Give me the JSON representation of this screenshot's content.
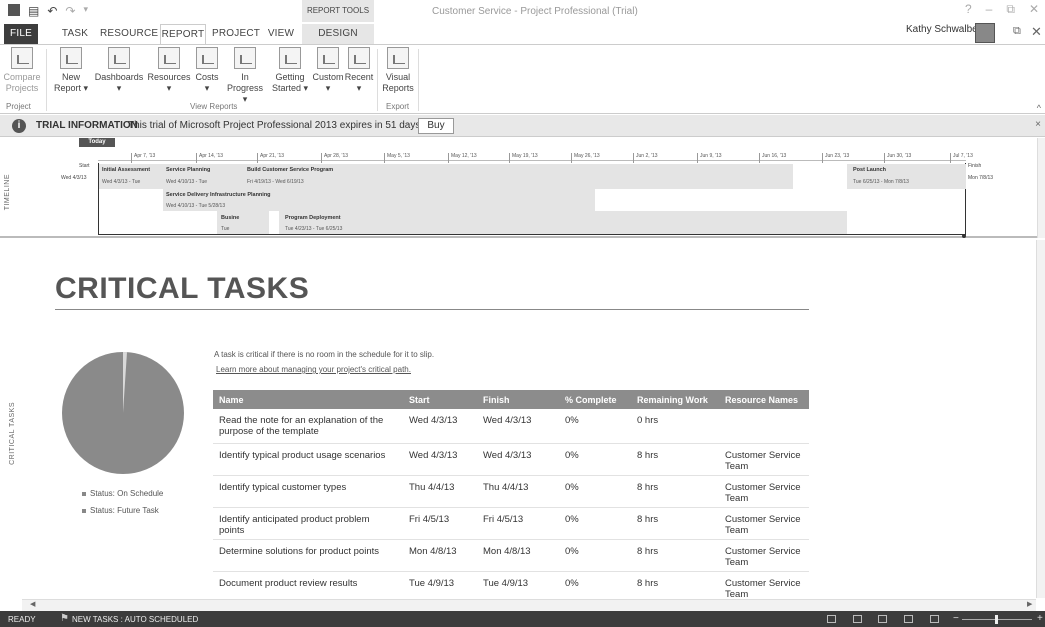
{
  "titlebar": {
    "context_title": "REPORT TOOLS",
    "doc_title": "Customer Service - Project Professional (Trial)",
    "help": "?",
    "minimize": "–",
    "restore": "⧉",
    "close": "✕"
  },
  "tabs": [
    {
      "label": "FILE"
    },
    {
      "label": "TASK"
    },
    {
      "label": "RESOURCE"
    },
    {
      "label": "REPORT"
    },
    {
      "label": "PROJECT"
    },
    {
      "label": "VIEW"
    },
    {
      "label": "DESIGN"
    }
  ],
  "user": {
    "name": "Kathy Schwalbe ▾",
    "restore": "⧉",
    "close": "✕"
  },
  "ribbon": {
    "buttons": [
      {
        "label1": "Compare",
        "label2": "Projects",
        "icon": "compare-projects-icon"
      },
      {
        "label1": "New",
        "label2": "Report ▾",
        "icon": "new-report-icon"
      },
      {
        "label1": "Dashboards",
        "label2": "▾",
        "icon": "dashboards-icon"
      },
      {
        "label1": "Resources",
        "label2": "▾",
        "icon": "resources-icon"
      },
      {
        "label1": "Costs",
        "label2": "▾",
        "icon": "costs-icon"
      },
      {
        "label1": "In Progress",
        "label2": "▾",
        "icon": "in-progress-icon"
      },
      {
        "label1": "Getting",
        "label2": "Started ▾",
        "icon": "getting-started-icon"
      },
      {
        "label1": "Custom",
        "label2": "▾",
        "icon": "custom-icon"
      },
      {
        "label1": "Recent",
        "label2": "▾",
        "icon": "recent-icon"
      },
      {
        "label1": "Visual",
        "label2": "Reports",
        "icon": "visual-reports-icon"
      }
    ],
    "groups": [
      "Project",
      "View Reports",
      "Export"
    ],
    "collapse": "^"
  },
  "trial": {
    "heading": "TRIAL INFORMATION",
    "message": "This trial of Microsoft Project Professional 2013 expires in 51 days.",
    "buy": "Buy",
    "close": "×",
    "info_glyph": "i"
  },
  "timeline": {
    "side_label": "TIMELINE",
    "today": "Today",
    "start_label": "Start",
    "start_date": "Wed 4/3/13",
    "finish_label": "Finish",
    "finish_date": "Mon 7/8/13",
    "dates": [
      "Apr 7, '13",
      "Apr 14, '13",
      "Apr 21, '13",
      "Apr 28, '13",
      "May 5, '13",
      "May 12, '13",
      "May 19, '13",
      "May 26, '13",
      "Jun 2, '13",
      "Jun 9, '13",
      "Jun 16, '13",
      "Jun 23, '13",
      "Jun 30, '13",
      "Jul 7, '13"
    ],
    "tasks": [
      {
        "name": "Initial Assessment",
        "dates": "Wed 4/3/13 - Tue"
      },
      {
        "name": "Service Planning",
        "dates": "Wed 4/10/13 - Tue"
      },
      {
        "name": "Build Customer Service Program",
        "dates": "Fri 4/19/13 - Wed 6/19/13"
      },
      {
        "name": "Post Launch",
        "dates": "Tue 6/25/13 - Mon 7/8/13"
      },
      {
        "name": "Service Delivery Infrastructure Planning",
        "dates": "Wed 4/10/13 - Tue 5/28/13"
      },
      {
        "name": "Busine",
        "dates": "Tue"
      },
      {
        "name": "Program Deployment",
        "dates": "Tue 4/23/13 - Tue 6/25/13"
      }
    ]
  },
  "report": {
    "side_label": "CRITICAL TASKS",
    "title": "CRITICAL TASKS",
    "description": "A task is critical if there is no room in the schedule for it to slip.",
    "link": "Learn more about managing your project's critical path.",
    "legend": [
      "Status: On Schedule",
      "Status: Future Task"
    ],
    "colors": {
      "pie_main": "#8a8a8a",
      "pie_slice": "#d9d9d9",
      "header": "#8c8c8c"
    },
    "table": {
      "headers": [
        "Name",
        "Start",
        "Finish",
        "% Complete",
        "Remaining Work",
        "Resource Names"
      ],
      "rows": [
        [
          "Read the note for an explanation of the purpose of the template",
          "Wed 4/3/13",
          "Wed 4/3/13",
          "0%",
          "0 hrs",
          ""
        ],
        [
          "Identify typical product usage scenarios",
          "Wed 4/3/13",
          "Wed 4/3/13",
          "0%",
          "8 hrs",
          "Customer Service Team"
        ],
        [
          "Identify typical customer types",
          "Thu 4/4/13",
          "Thu 4/4/13",
          "0%",
          "8 hrs",
          "Customer Service Team"
        ],
        [
          "Identify anticipated product problem points",
          "Fri 4/5/13",
          "Fri 4/5/13",
          "0%",
          "8 hrs",
          "Customer Service Team"
        ],
        [
          "Determine solutions for product points",
          "Mon 4/8/13",
          "Mon 4/8/13",
          "0%",
          "8 hrs",
          "Customer Service Team"
        ],
        [
          "Document product review results",
          "Tue 4/9/13",
          "Tue 4/9/13",
          "0%",
          "8 hrs",
          "Customer Service Team"
        ]
      ]
    }
  },
  "status": {
    "ready": "READY",
    "new_tasks": "NEW TASKS : AUTO SCHEDULED",
    "zoom_minus": "−",
    "zoom_plus": "+"
  }
}
